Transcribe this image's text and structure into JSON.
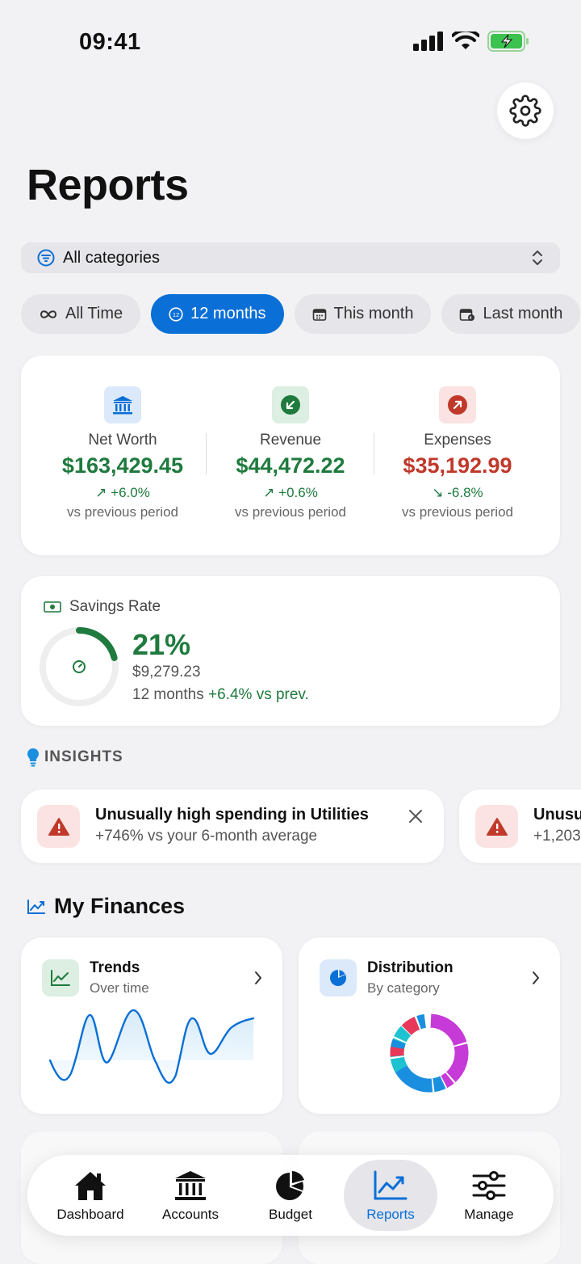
{
  "status_bar": {
    "time": "09:41"
  },
  "page": {
    "title": "Reports"
  },
  "filter": {
    "category_label": "All categories"
  },
  "chips": [
    {
      "label": "All Time",
      "icon": "infinity-icon",
      "active": false
    },
    {
      "label": "12 months",
      "icon": "clock-12-icon",
      "active": true
    },
    {
      "label": "This month",
      "icon": "calendar-icon",
      "active": false
    },
    {
      "label": "Last month",
      "icon": "calendar-back-icon",
      "active": false
    }
  ],
  "summary": {
    "net_worth": {
      "name": "Net Worth",
      "amount": "$163,429.45",
      "delta": "↗ +6.0%",
      "sub": "vs previous period"
    },
    "revenue": {
      "name": "Revenue",
      "amount": "$44,472.22",
      "delta": "↗ +0.6%",
      "sub": "vs previous period"
    },
    "expenses": {
      "name": "Expenses",
      "amount": "$35,192.99",
      "delta": "↘ -6.8%",
      "sub": "vs previous period"
    }
  },
  "savings": {
    "title": "Savings Rate",
    "percent": "21%",
    "percent_value": 0.21,
    "amount": "$9,279.23",
    "period": "12 months",
    "change": "+6.4% vs prev."
  },
  "insights": {
    "header": "INSIGHTS",
    "items": [
      {
        "title": "Unusually high spending in Utilities",
        "detail": "+746% vs your 6-month average"
      },
      {
        "title": "Unusu",
        "detail": "+1,203"
      }
    ]
  },
  "finances": {
    "title": "My Finances",
    "cards": [
      {
        "title": "Trends",
        "subtitle": "Over time"
      },
      {
        "title": "Distribution",
        "subtitle": "By category"
      }
    ]
  },
  "tabs": [
    {
      "label": "Dashboard",
      "icon": "house-icon"
    },
    {
      "label": "Accounts",
      "icon": "bank-icon"
    },
    {
      "label": "Budget",
      "icon": "pie-chart-icon"
    },
    {
      "label": "Reports",
      "icon": "trend-chart-icon",
      "active": true
    },
    {
      "label": "Manage",
      "icon": "sliders-icon"
    }
  ],
  "colors": {
    "accent": "#0a6fd6",
    "positive": "#1f7a3e",
    "negative": "#c0392b",
    "donut": [
      "#c63bd8",
      "#1a8fe0",
      "#1ec2d0",
      "#e8385a"
    ]
  }
}
